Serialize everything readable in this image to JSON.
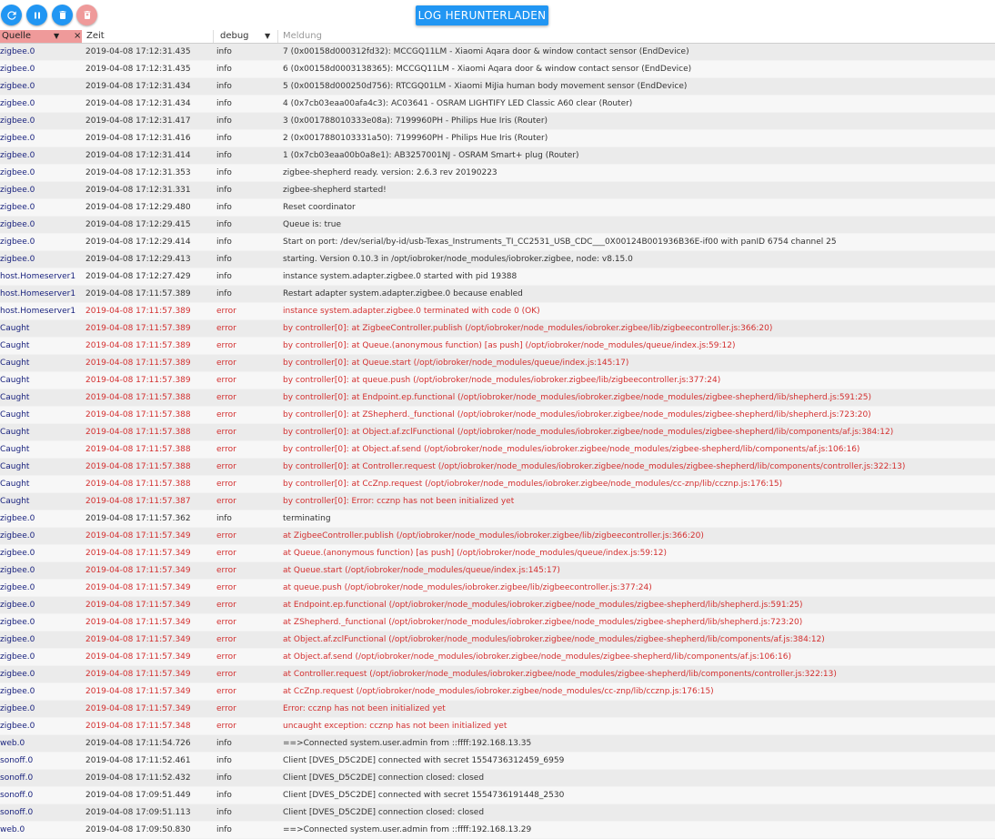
{
  "toolbar": {
    "refresh_icon": "refresh-icon",
    "pause_icon": "pause-icon",
    "clear_icon": "trash-icon",
    "delete_icon": "delete-icon",
    "download_label": "LOG HERUNTERLADEN"
  },
  "filters": {
    "source_value": "Quelle",
    "time_placeholder": "Zeit",
    "level_value": "debug",
    "message_placeholder": "Meldung"
  },
  "colors": {
    "accent": "#2196f3",
    "source_filter_bg": "#ef9a9a",
    "error_text": "#d32f2f",
    "source_text": "#1a237e"
  },
  "rows": [
    {
      "source": "zigbee.0",
      "time": "2019-04-08 17:12:31.435",
      "level": "info",
      "message": "7 (0x00158d000312fd32): MCCGQ11LM - Xiaomi Aqara door & window contact sensor (EndDevice)"
    },
    {
      "source": "zigbee.0",
      "time": "2019-04-08 17:12:31.435",
      "level": "info",
      "message": "6 (0x00158d0003138365): MCCGQ11LM - Xiaomi Aqara door & window contact sensor (EndDevice)"
    },
    {
      "source": "zigbee.0",
      "time": "2019-04-08 17:12:31.434",
      "level": "info",
      "message": "5 (0x00158d000250d756): RTCGQ01LM - Xiaomi MiJia human body movement sensor (EndDevice)"
    },
    {
      "source": "zigbee.0",
      "time": "2019-04-08 17:12:31.434",
      "level": "info",
      "message": "4 (0x7cb03eaa00afa4c3): AC03641 - OSRAM LIGHTIFY LED Classic A60 clear (Router)"
    },
    {
      "source": "zigbee.0",
      "time": "2019-04-08 17:12:31.417",
      "level": "info",
      "message": "3 (0x001788010333e08a): 7199960PH - Philips Hue Iris (Router)"
    },
    {
      "source": "zigbee.0",
      "time": "2019-04-08 17:12:31.416",
      "level": "info",
      "message": "2 (0x0017880103331a50): 7199960PH - Philips Hue Iris (Router)"
    },
    {
      "source": "zigbee.0",
      "time": "2019-04-08 17:12:31.414",
      "level": "info",
      "message": "1 (0x7cb03eaa00b0a8e1): AB3257001NJ - OSRAM Smart+ plug (Router)"
    },
    {
      "source": "zigbee.0",
      "time": "2019-04-08 17:12:31.353",
      "level": "info",
      "message": "zigbee-shepherd ready. version: 2.6.3 rev 20190223"
    },
    {
      "source": "zigbee.0",
      "time": "2019-04-08 17:12:31.331",
      "level": "info",
      "message": "zigbee-shepherd started!"
    },
    {
      "source": "zigbee.0",
      "time": "2019-04-08 17:12:29.480",
      "level": "info",
      "message": "Reset coordinator"
    },
    {
      "source": "zigbee.0",
      "time": "2019-04-08 17:12:29.415",
      "level": "info",
      "message": "Queue is: true"
    },
    {
      "source": "zigbee.0",
      "time": "2019-04-08 17:12:29.414",
      "level": "info",
      "message": "Start on port: /dev/serial/by-id/usb-Texas_Instruments_TI_CC2531_USB_CDC___0X00124B001936B36E-if00 with panID 6754 channel 25"
    },
    {
      "source": "zigbee.0",
      "time": "2019-04-08 17:12:29.413",
      "level": "info",
      "message": "starting. Version 0.10.3 in /opt/iobroker/node_modules/iobroker.zigbee, node: v8.15.0"
    },
    {
      "source": "host.Homeserver1",
      "time": "2019-04-08 17:12:27.429",
      "level": "info",
      "message": "instance system.adapter.zigbee.0 started with pid 19388"
    },
    {
      "source": "host.Homeserver1",
      "time": "2019-04-08 17:11:57.389",
      "level": "info",
      "message": "Restart adapter system.adapter.zigbee.0 because enabled"
    },
    {
      "source": "host.Homeserver1",
      "time": "2019-04-08 17:11:57.389",
      "level": "error",
      "message": "instance system.adapter.zigbee.0 terminated with code 0 (OK)"
    },
    {
      "source": "Caught",
      "time": "2019-04-08 17:11:57.389",
      "level": "error",
      "message": "by controller[0]: at ZigbeeController.publish (/opt/iobroker/node_modules/iobroker.zigbee/lib/zigbeecontroller.js:366:20)"
    },
    {
      "source": "Caught",
      "time": "2019-04-08 17:11:57.389",
      "level": "error",
      "message": "by controller[0]: at Queue.(anonymous function) [as push] (/opt/iobroker/node_modules/queue/index.js:59:12)"
    },
    {
      "source": "Caught",
      "time": "2019-04-08 17:11:57.389",
      "level": "error",
      "message": "by controller[0]: at Queue.start (/opt/iobroker/node_modules/queue/index.js:145:17)"
    },
    {
      "source": "Caught",
      "time": "2019-04-08 17:11:57.389",
      "level": "error",
      "message": "by controller[0]: at queue.push (/opt/iobroker/node_modules/iobroker.zigbee/lib/zigbeecontroller.js:377:24)"
    },
    {
      "source": "Caught",
      "time": "2019-04-08 17:11:57.388",
      "level": "error",
      "message": "by controller[0]: at Endpoint.ep.functional (/opt/iobroker/node_modules/iobroker.zigbee/node_modules/zigbee-shepherd/lib/shepherd.js:591:25)"
    },
    {
      "source": "Caught",
      "time": "2019-04-08 17:11:57.388",
      "level": "error",
      "message": "by controller[0]: at ZShepherd._functional (/opt/iobroker/node_modules/iobroker.zigbee/node_modules/zigbee-shepherd/lib/shepherd.js:723:20)"
    },
    {
      "source": "Caught",
      "time": "2019-04-08 17:11:57.388",
      "level": "error",
      "message": "by controller[0]: at Object.af.zclFunctional (/opt/iobroker/node_modules/iobroker.zigbee/node_modules/zigbee-shepherd/lib/components/af.js:384:12)"
    },
    {
      "source": "Caught",
      "time": "2019-04-08 17:11:57.388",
      "level": "error",
      "message": "by controller[0]: at Object.af.send (/opt/iobroker/node_modules/iobroker.zigbee/node_modules/zigbee-shepherd/lib/components/af.js:106:16)"
    },
    {
      "source": "Caught",
      "time": "2019-04-08 17:11:57.388",
      "level": "error",
      "message": "by controller[0]: at Controller.request (/opt/iobroker/node_modules/iobroker.zigbee/node_modules/zigbee-shepherd/lib/components/controller.js:322:13)"
    },
    {
      "source": "Caught",
      "time": "2019-04-08 17:11:57.388",
      "level": "error",
      "message": "by controller[0]: at CcZnp.request (/opt/iobroker/node_modules/iobroker.zigbee/node_modules/cc-znp/lib/ccznp.js:176:15)"
    },
    {
      "source": "Caught",
      "time": "2019-04-08 17:11:57.387",
      "level": "error",
      "message": "by controller[0]: Error: ccznp has not been initialized yet"
    },
    {
      "source": "zigbee.0",
      "time": "2019-04-08 17:11:57.362",
      "level": "info",
      "message": "terminating"
    },
    {
      "source": "zigbee.0",
      "time": "2019-04-08 17:11:57.349",
      "level": "error",
      "message": "at ZigbeeController.publish (/opt/iobroker/node_modules/iobroker.zigbee/lib/zigbeecontroller.js:366:20)"
    },
    {
      "source": "zigbee.0",
      "time": "2019-04-08 17:11:57.349",
      "level": "error",
      "message": "at Queue.(anonymous function) [as push] (/opt/iobroker/node_modules/queue/index.js:59:12)"
    },
    {
      "source": "zigbee.0",
      "time": "2019-04-08 17:11:57.349",
      "level": "error",
      "message": "at Queue.start (/opt/iobroker/node_modules/queue/index.js:145:17)"
    },
    {
      "source": "zigbee.0",
      "time": "2019-04-08 17:11:57.349",
      "level": "error",
      "message": "at queue.push (/opt/iobroker/node_modules/iobroker.zigbee/lib/zigbeecontroller.js:377:24)"
    },
    {
      "source": "zigbee.0",
      "time": "2019-04-08 17:11:57.349",
      "level": "error",
      "message": "at Endpoint.ep.functional (/opt/iobroker/node_modules/iobroker.zigbee/node_modules/zigbee-shepherd/lib/shepherd.js:591:25)"
    },
    {
      "source": "zigbee.0",
      "time": "2019-04-08 17:11:57.349",
      "level": "error",
      "message": "at ZShepherd._functional (/opt/iobroker/node_modules/iobroker.zigbee/node_modules/zigbee-shepherd/lib/shepherd.js:723:20)"
    },
    {
      "source": "zigbee.0",
      "time": "2019-04-08 17:11:57.349",
      "level": "error",
      "message": "at Object.af.zclFunctional (/opt/iobroker/node_modules/iobroker.zigbee/node_modules/zigbee-shepherd/lib/components/af.js:384:12)"
    },
    {
      "source": "zigbee.0",
      "time": "2019-04-08 17:11:57.349",
      "level": "error",
      "message": "at Object.af.send (/opt/iobroker/node_modules/iobroker.zigbee/node_modules/zigbee-shepherd/lib/components/af.js:106:16)"
    },
    {
      "source": "zigbee.0",
      "time": "2019-04-08 17:11:57.349",
      "level": "error",
      "message": "at Controller.request (/opt/iobroker/node_modules/iobroker.zigbee/node_modules/zigbee-shepherd/lib/components/controller.js:322:13)"
    },
    {
      "source": "zigbee.0",
      "time": "2019-04-08 17:11:57.349",
      "level": "error",
      "message": "at CcZnp.request (/opt/iobroker/node_modules/iobroker.zigbee/node_modules/cc-znp/lib/ccznp.js:176:15)"
    },
    {
      "source": "zigbee.0",
      "time": "2019-04-08 17:11:57.349",
      "level": "error",
      "message": "Error: ccznp has not been initialized yet"
    },
    {
      "source": "zigbee.0",
      "time": "2019-04-08 17:11:57.348",
      "level": "error",
      "message": "uncaught exception: ccznp has not been initialized yet"
    },
    {
      "source": "web.0",
      "time": "2019-04-08 17:11:54.726",
      "level": "info",
      "message": "==>Connected system.user.admin from ::ffff:192.168.13.35"
    },
    {
      "source": "sonoff.0",
      "time": "2019-04-08 17:11:52.461",
      "level": "info",
      "message": "Client [DVES_D5C2DE] connected with secret 1554736312459_6959"
    },
    {
      "source": "sonoff.0",
      "time": "2019-04-08 17:11:52.432",
      "level": "info",
      "message": "Client [DVES_D5C2DE] connection closed: closed"
    },
    {
      "source": "sonoff.0",
      "time": "2019-04-08 17:09:51.449",
      "level": "info",
      "message": "Client [DVES_D5C2DE] connected with secret 1554736191448_2530"
    },
    {
      "source": "sonoff.0",
      "time": "2019-04-08 17:09:51.113",
      "level": "info",
      "message": "Client [DVES_D5C2DE] connection closed: closed"
    },
    {
      "source": "web.0",
      "time": "2019-04-08 17:09:50.830",
      "level": "info",
      "message": "==>Connected system.user.admin from ::ffff:192.168.13.29"
    }
  ]
}
